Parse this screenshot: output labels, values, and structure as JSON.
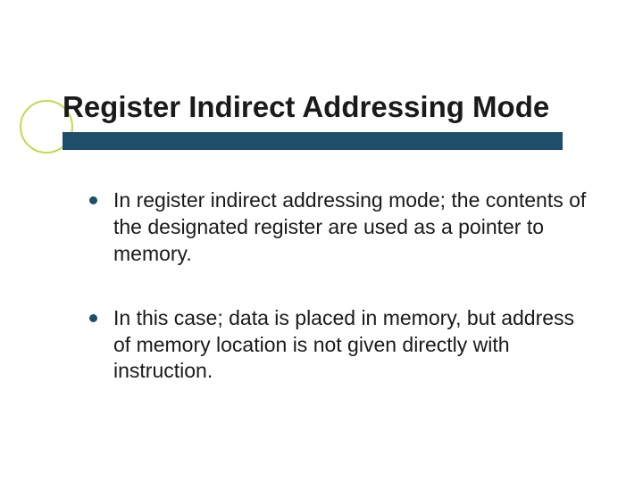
{
  "title": "Register Indirect Addressing Mode",
  "bullets": [
    "In register indirect addressing mode; the contents of the designated register are used as a pointer to memory.",
    "In this case; data is placed in memory, but address of memory location is not given directly with instruction."
  ],
  "colors": {
    "accent_bar": "#1f4e6a",
    "accent_circle": "#c5d94a"
  }
}
